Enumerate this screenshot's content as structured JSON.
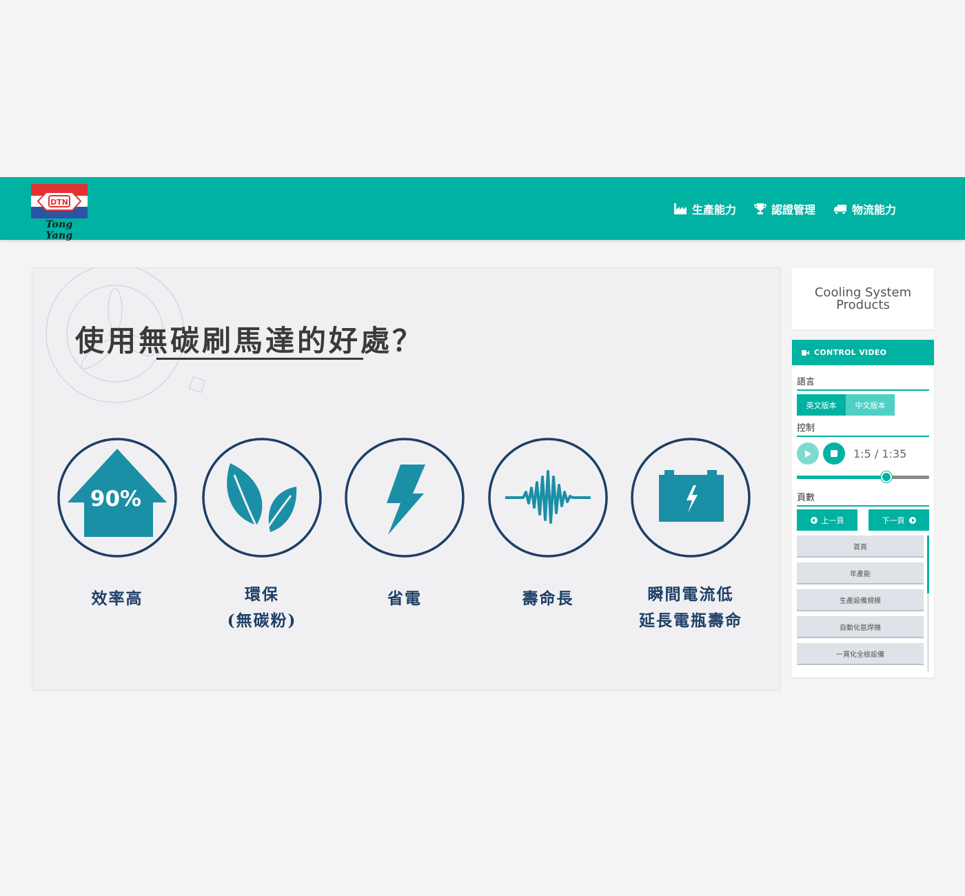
{
  "brand": {
    "logo_text": "Tong Yang",
    "emblem_text": "DTN",
    "colors": {
      "header": "#00b2a2",
      "logo_red": "#e3312f",
      "logo_blue": "#2a55a5",
      "navy": "#1e3f66",
      "teal_icon": "#1b8fa5"
    }
  },
  "nav": {
    "items": [
      {
        "label": "生產能力",
        "icon": "factory-icon"
      },
      {
        "label": "認證管理",
        "icon": "trophy-icon"
      },
      {
        "label": "物流能力",
        "icon": "truck-icon"
      }
    ]
  },
  "slide": {
    "title": "使用無碳刷馬達的好處？",
    "benefits": [
      {
        "icon": "arrow-up-90-icon",
        "icon_text": "90%",
        "lines": [
          "效率高"
        ]
      },
      {
        "icon": "leaf-icon",
        "lines": [
          "環保",
          "(無碳粉)"
        ]
      },
      {
        "icon": "lightning-icon",
        "lines": [
          "省電"
        ]
      },
      {
        "icon": "waveform-icon",
        "lines": [
          "壽命長"
        ]
      },
      {
        "icon": "battery-icon",
        "lines": [
          "瞬間電流低",
          "延長電瓶壽命"
        ]
      }
    ]
  },
  "panel": {
    "product_title": [
      "Cooling System",
      "Products"
    ],
    "control_heading": "CONTROL VIDEO",
    "language_label": "語言",
    "languages": [
      "英文版本",
      "中文版本"
    ],
    "control_label": "控制",
    "time_display": "1:5 / 1:35",
    "progress": 0.6771,
    "pages_label": "頁數",
    "prev_label": "上一頁",
    "next_label": "下一頁",
    "page_items": [
      "首頁",
      "年產能",
      "生產設備規模",
      "自動化氬焊機",
      "一貫化全檢設備"
    ]
  }
}
